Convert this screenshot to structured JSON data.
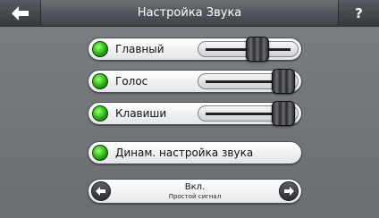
{
  "header": {
    "title": "Настройка Звука",
    "back_icon": "arrow-left-icon",
    "help_label": "?"
  },
  "sliders": [
    {
      "label": "Главный",
      "enabled": true,
      "level": 0.62
    },
    {
      "label": "Голос",
      "enabled": true,
      "level": 0.97
    },
    {
      "label": "Клавиши",
      "enabled": true,
      "level": 0.97
    }
  ],
  "dynamic": {
    "label": "Динам. настройка звука",
    "enabled": true
  },
  "selector": {
    "value": "Вкл.",
    "subtitle": "Простой сигнал"
  },
  "colors": {
    "led_on": "#35c31a",
    "header_bg": "#50535a",
    "screen_bg": "#6f7276"
  }
}
